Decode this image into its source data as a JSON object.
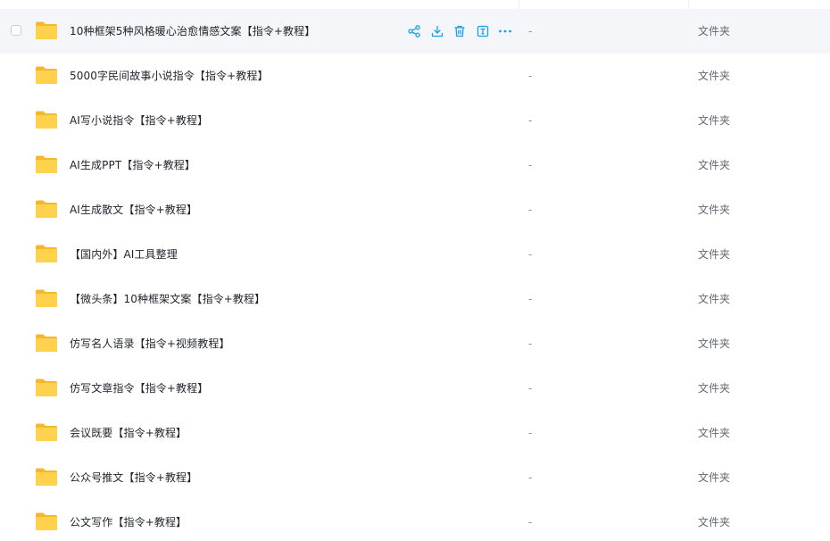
{
  "columns": {
    "size_placeholder": "-",
    "type_label": "文件夹"
  },
  "accent_color": "#1ba1e2",
  "folder_color": "#ffd24d",
  "hover_actions": [
    "share-icon",
    "download-icon",
    "delete-icon",
    "rename-icon",
    "more-icon"
  ],
  "files": [
    {
      "name": "10种框架5种风格暖心治愈情感文案【指令+教程】",
      "size": "-",
      "type": "文件夹"
    },
    {
      "name": "5000字民间故事小说指令【指令+教程】",
      "size": "-",
      "type": "文件夹"
    },
    {
      "name": "AI写小说指令【指令+教程】",
      "size": "-",
      "type": "文件夹"
    },
    {
      "name": "AI生成PPT【指令+教程】",
      "size": "-",
      "type": "文件夹"
    },
    {
      "name": "AI生成散文【指令+教程】",
      "size": "-",
      "type": "文件夹"
    },
    {
      "name": "【国内外】AI工具整理",
      "size": "-",
      "type": "文件夹"
    },
    {
      "name": "【微头条】10种框架文案【指令+教程】",
      "size": "-",
      "type": "文件夹"
    },
    {
      "name": "仿写名人语录【指令+视频教程】",
      "size": "-",
      "type": "文件夹"
    },
    {
      "name": "仿写文章指令【指令+教程】",
      "size": "-",
      "type": "文件夹"
    },
    {
      "name": "会议既要【指令+教程】",
      "size": "-",
      "type": "文件夹"
    },
    {
      "name": "公众号推文【指令+教程】",
      "size": "-",
      "type": "文件夹"
    },
    {
      "name": "公文写作【指令+教程】",
      "size": "-",
      "type": "文件夹"
    }
  ]
}
